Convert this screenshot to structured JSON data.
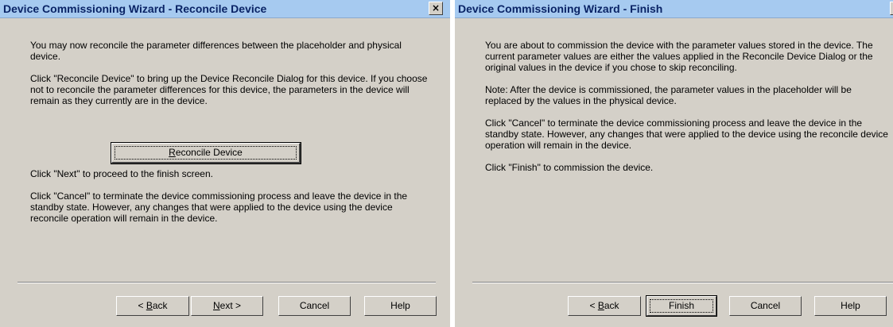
{
  "left_dialog": {
    "title": "Device Commissioning Wizard - Reconcile Device",
    "close_glyph": "×",
    "para1": "You may now reconcile the parameter differences between the placeholder and physical device.",
    "para2": "Click \"Reconcile Device\" to bring up the Device Reconcile Dialog for this device. If you choose not to reconcile the parameter differences for this device, the parameters in the device will remain as they currently are in the device.",
    "reconcile_button": {
      "first": "R",
      "rest": "econcile Device"
    },
    "para3": "Click \"Next\" to proceed to the finish screen.",
    "para4": "Click \"Cancel\" to terminate the device commissioning process and leave the device in the standby state. However, any changes that were applied to the device using the device reconcile operation will remain in the device.",
    "buttons": {
      "back": {
        "prefix": "< ",
        "mnemonic": "B",
        "rest": "ack"
      },
      "next": {
        "mnemonic": "N",
        "rest": "ext >"
      },
      "cancel": "Cancel",
      "help": "Help"
    }
  },
  "right_dialog": {
    "title": "Device Commissioning Wizard - Finish",
    "close_glyph": "×",
    "para1": "You are about to commission the device with the parameter values stored in the device. The current parameter values are either the values applied in the Reconcile Device Dialog or the original values in the device if you chose to skip reconciling.",
    "para2": "Note: After the device is commissioned, the parameter values in the placeholder will be replaced by the values in the physical device.",
    "para3": "Click \"Cancel\" to terminate the device commissioning process and leave the device in the standby state. However, any changes that were applied to the device using the reconcile device operation will remain in the device.",
    "para4": "Click \"Finish\" to commission the device.",
    "buttons": {
      "back": {
        "prefix": "< ",
        "mnemonic": "B",
        "rest": "ack"
      },
      "finish": "Finish",
      "cancel": "Cancel",
      "help": "Help"
    }
  }
}
